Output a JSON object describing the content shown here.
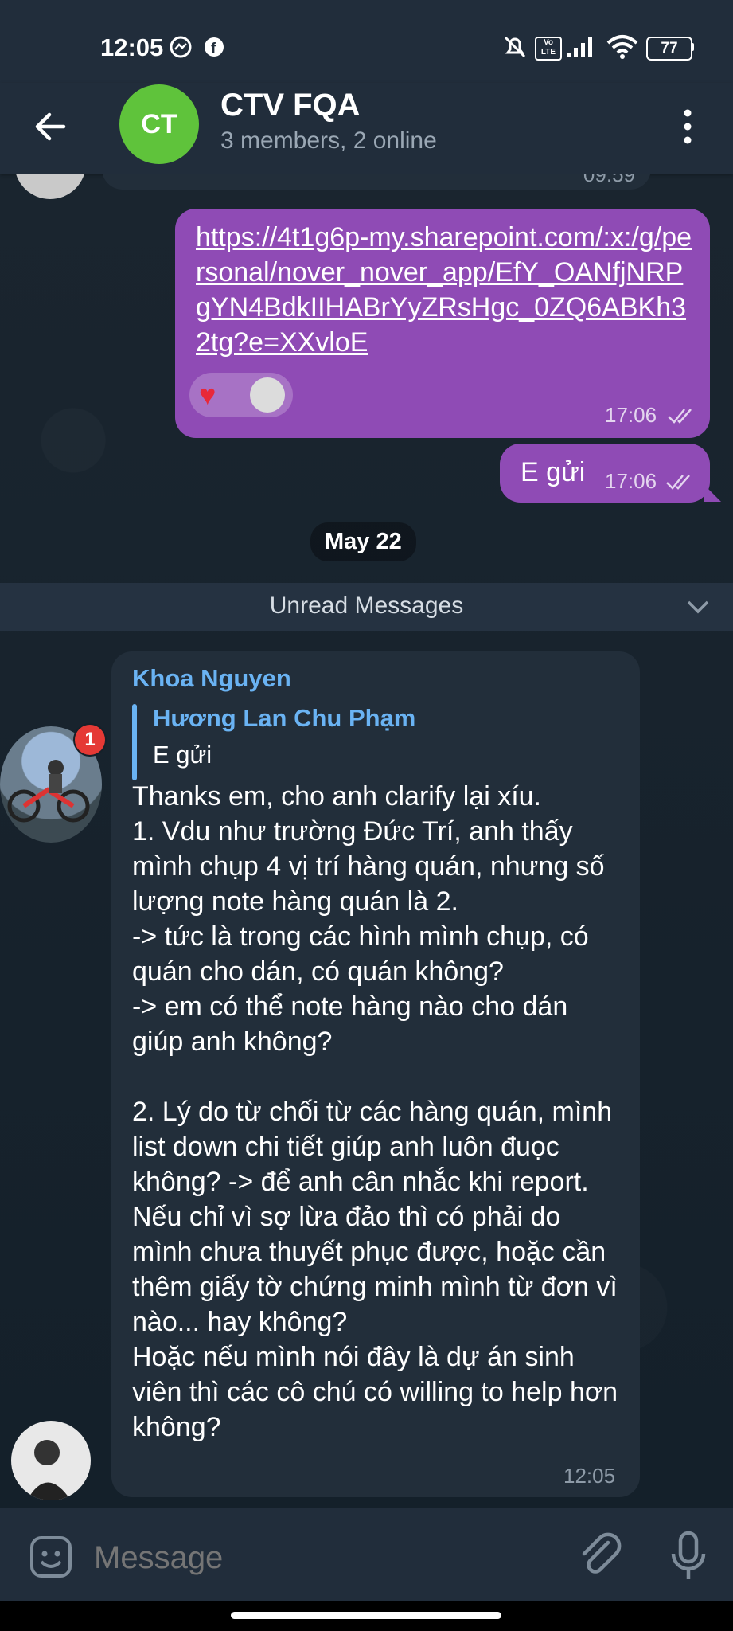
{
  "status": {
    "time": "12:05",
    "battery": "77"
  },
  "header": {
    "title": "CTV FQA",
    "subtitle": "3 members, 2 online",
    "avatar_initials": "CT",
    "avatar_color": "#5fc33b"
  },
  "messages": {
    "prev_time": "09:59",
    "link": {
      "text": "https://4t1g6p-my.sharepoint.com/:x:/g/personal/nover_nover_app/EfY_OANfjNRPgYN4BdkIIHABrYyZRsHgc_0ZQ6ABKh32tg?e=XXvloE",
      "time": "17:06",
      "reaction": "❤️"
    },
    "egui": {
      "text": "E gửi",
      "time": "17:06"
    },
    "date_chip": "May 22",
    "unread_label": "Unread Messages",
    "incoming": {
      "sender": "Khoa Nguyen",
      "reply_name": "Hương Lan Chu Phạm",
      "reply_text": "E gửi",
      "body": "Thanks em, cho anh clarify lại xíu.\n1. Vdu như trường Đức Trí, anh thấy mình chụp 4 vị trí hàng quán, nhưng số lượng note hàng quán là 2.\n-> tức là trong các hình mình chụp, có quán cho dán, có quán không?\n-> em có thể note hàng nào cho dán giúp anh không?\n\n2. Lý do từ chối từ các hàng quán, mình list down chi tiết giúp anh luôn đuọc không? -> để anh cân nhắc khi report. Nếu chỉ vì sợ lừa đảo thì có phải do mình chưa thuyết phục được, hoặc cần thêm giấy tờ chứng minh mình từ đơn vì nào... hay không?\nHoặc nếu mình nói đây là dự án sinh viên thì các cô chú có willing to help hơn không?",
      "time": "12:05",
      "badge": "1"
    }
  },
  "composer": {
    "placeholder": "Message"
  },
  "colors": {
    "accent_name": "#6ab3f3",
    "outgoing": "#8f4bb5",
    "incoming": "#222e3a"
  }
}
